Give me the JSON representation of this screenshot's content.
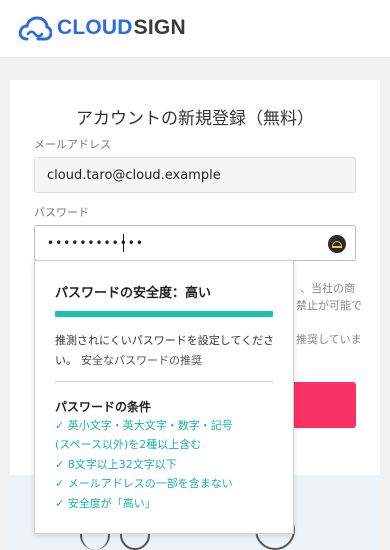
{
  "header": {
    "logo_cloud": "CLOUD",
    "logo_sign": "SIGN"
  },
  "form": {
    "title": "アカウントの新規登録（無料）",
    "email_label": "メールアドレス",
    "email_value": "cloud.taro@cloud.example",
    "password_label": "パスワード",
    "password_value": "••••••••••••"
  },
  "background_fragments": {
    "line1": "、当社の商",
    "line2": "禁止が可能で",
    "line3": "推奨していま"
  },
  "popover": {
    "strength_title": "パスワードの安全度：高い",
    "strength_level": 1.0,
    "description": "推測されにくいパスワードを設定してください。",
    "recommend_link": "安全なパスワードの推奨",
    "conditions_title": "パスワードの条件",
    "conditions": [
      "✓ 英小文字・英大文字・数字・記号",
      "(スペース以外)を2種以上含む",
      "✓ 8文字以上32文字以下",
      "✓ メールアドレスの一部を含まない",
      "✓ 安全度が「高い」"
    ]
  },
  "colors": {
    "brand": "#2d6cdf",
    "accent": "#f73163",
    "success": "#1cc0b0"
  }
}
